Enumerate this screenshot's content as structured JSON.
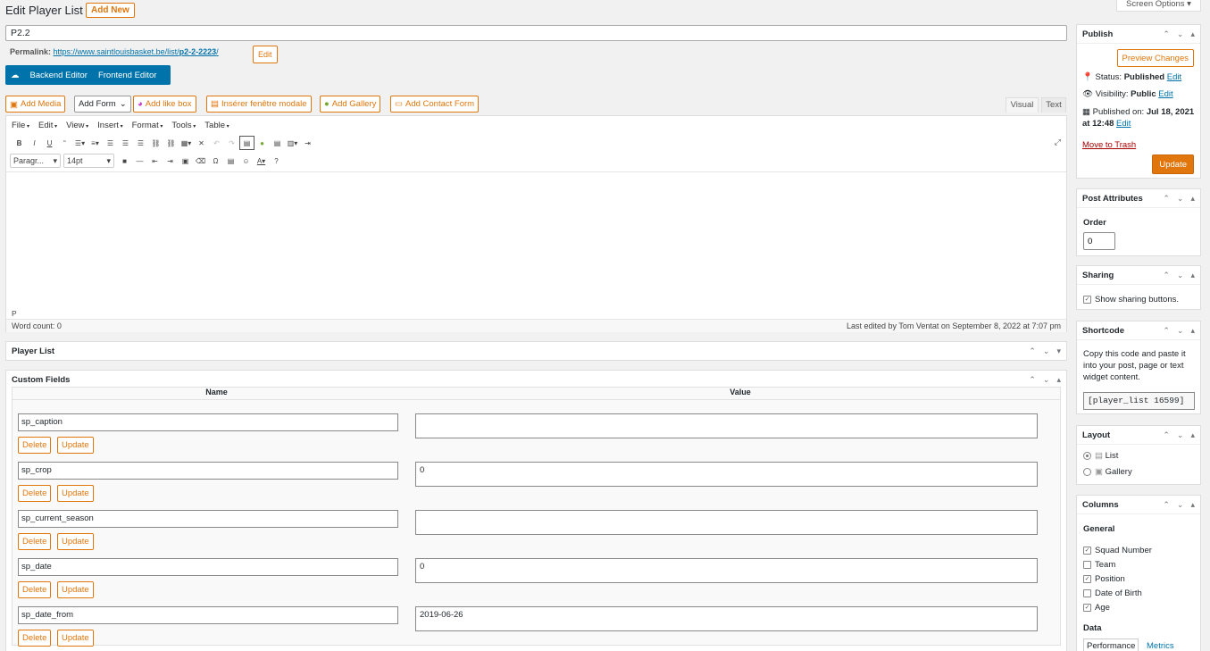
{
  "page": {
    "title": "Edit Player List",
    "add_new": "Add New",
    "screen_options": "Screen Options"
  },
  "post": {
    "title_value": "P2.2",
    "permalink_label": "Permalink:",
    "permalink_base": "https://www.saintlouisbasket.be/list/",
    "permalink_slug": "p2-2-2223",
    "permalink_end": "/",
    "permalink_edit": "Edit"
  },
  "builder": {
    "backend": "Backend Editor",
    "frontend": "Frontend Editor"
  },
  "media_buttons": {
    "add_media": "Add Media",
    "add_form": "Add Form",
    "add_like_box": "Add like box",
    "modal": "Insérer fenêtre modale",
    "add_gallery": "Add Gallery",
    "add_contact_form": "Add Contact Form"
  },
  "editor_tabs": {
    "visual": "Visual",
    "text": "Text"
  },
  "menubar": [
    "File",
    "Edit",
    "View",
    "Insert",
    "Format",
    "Tools",
    "Table"
  ],
  "toolbar": {
    "format_select": "Paragr...",
    "size_select": "14pt"
  },
  "editor": {
    "path": "P",
    "word_count": "Word count: 0",
    "last_edited": "Last edited by Tom Ventat on September 8, 2022 at 7:07 pm"
  },
  "boxes": {
    "player_list": "Player List",
    "custom_fields": "Custom Fields",
    "name_header": "Name",
    "value_header": "Value",
    "delete_label": "Delete",
    "update_label": "Update"
  },
  "custom_fields": [
    {
      "name": "sp_caption",
      "value": ""
    },
    {
      "name": "sp_crop",
      "value": "0"
    },
    {
      "name": "sp_current_season",
      "value": ""
    },
    {
      "name": "sp_date",
      "value": "0"
    },
    {
      "name": "sp_date_from",
      "value": "2019-06-26"
    }
  ],
  "publish": {
    "title": "Publish",
    "preview": "Preview Changes",
    "status_label": "Status:",
    "status_value": "Published",
    "visibility_label": "Visibility:",
    "visibility_value": "Public",
    "published_label": "Published on:",
    "published_value": "Jul 18, 2021 at 12:48",
    "edit": "Edit",
    "trash": "Move to Trash",
    "update": "Update"
  },
  "attributes": {
    "title": "Post Attributes",
    "order_label": "Order",
    "order_value": "0"
  },
  "sharing": {
    "title": "Sharing",
    "checkbox_label": "Show sharing buttons."
  },
  "shortcode": {
    "title": "Shortcode",
    "description": "Copy this code and paste it into your post, page or text widget content.",
    "code": "[player_list 16599]"
  },
  "layout": {
    "title": "Layout",
    "options": [
      "List",
      "Gallery"
    ],
    "selected": "List"
  },
  "columns": {
    "title": "Columns",
    "general_label": "General",
    "items": [
      {
        "label": "Squad Number",
        "checked": true
      },
      {
        "label": "Team",
        "checked": false
      },
      {
        "label": "Position",
        "checked": true
      },
      {
        "label": "Date of Birth",
        "checked": false
      },
      {
        "label": "Age",
        "checked": true
      }
    ],
    "data_label": "Data",
    "tabs": [
      "Performance",
      "Metrics"
    ]
  },
  "colors": {
    "accent": "#e0760c",
    "link": "#0073aa",
    "builder": "#0073aa"
  }
}
